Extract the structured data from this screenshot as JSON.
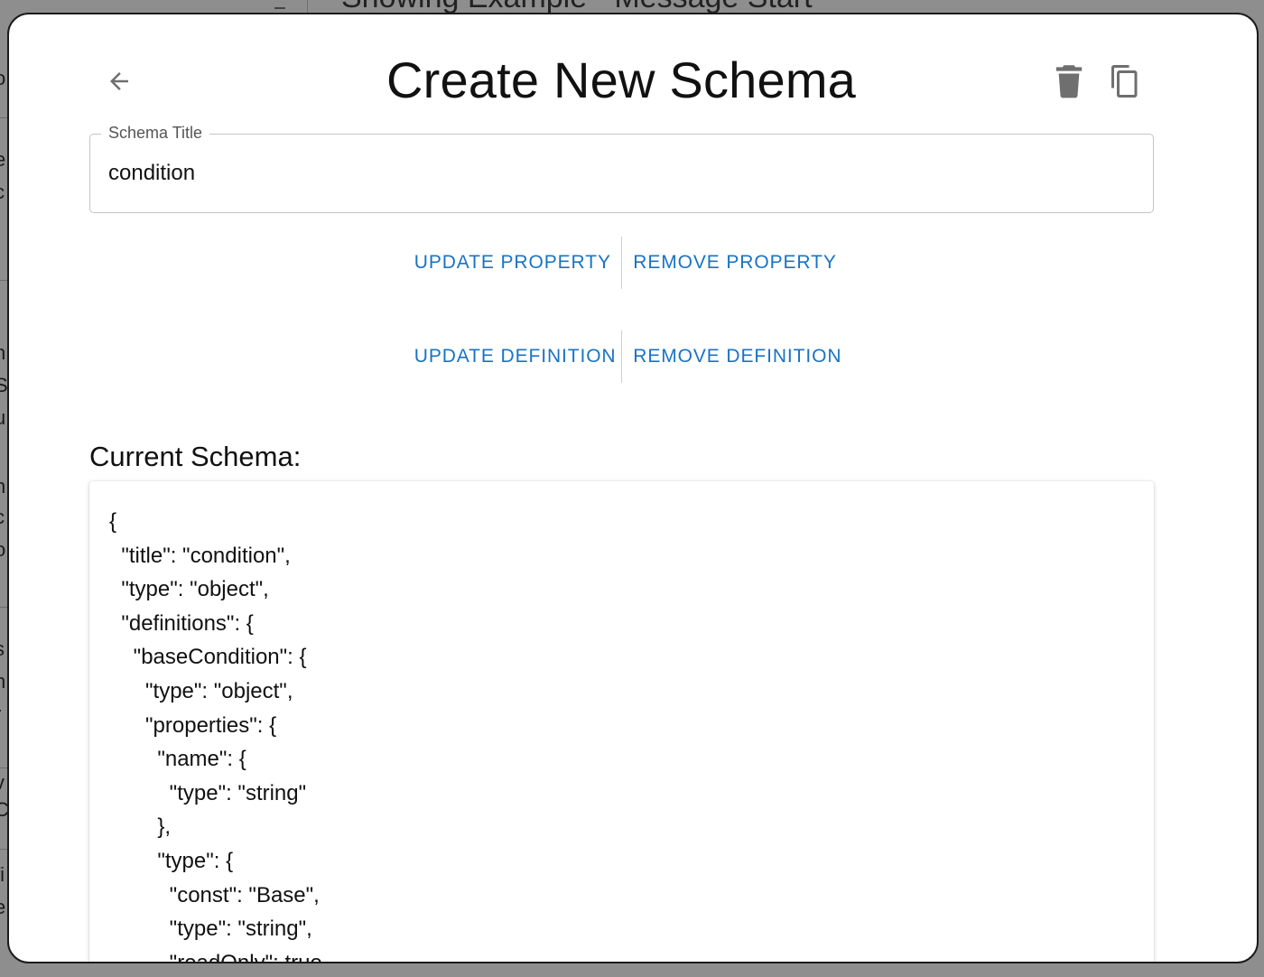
{
  "background": {
    "title_fragment": "Showing Example - Message Start",
    "left_edge_chars": [
      "o",
      "e",
      "c",
      "t",
      "n",
      "Sc",
      "u",
      "n",
      "c",
      "o",
      "s",
      "n",
      "r",
      "v",
      "C",
      "fi",
      "e"
    ]
  },
  "modal": {
    "title": "Create New Schema",
    "back_icon": "arrow-left-icon",
    "delete_icon": "trash-icon",
    "copy_icon": "copy-icon",
    "schema_title_field": {
      "label": "Schema Title",
      "value": "condition"
    },
    "actions_row1": {
      "update": "UPDATE PROPERTY",
      "remove": "REMOVE PROPERTY"
    },
    "actions_row2": {
      "update": "UPDATE DEFINITION",
      "remove": "REMOVE DEFINITION"
    },
    "current_schema_label": "Current Schema:",
    "current_schema_text": "{\n  \"title\": \"condition\",\n  \"type\": \"object\",\n  \"definitions\": {\n    \"baseCondition\": {\n      \"type\": \"object\",\n      \"properties\": {\n        \"name\": {\n          \"type\": \"string\"\n        },\n        \"type\": {\n          \"const\": \"Base\",\n          \"type\": \"string\",\n          \"readOnly\": true"
  },
  "colors": {
    "accent": "#1a73c2",
    "overlay": "#8e8e8e",
    "icon": "#707070"
  }
}
